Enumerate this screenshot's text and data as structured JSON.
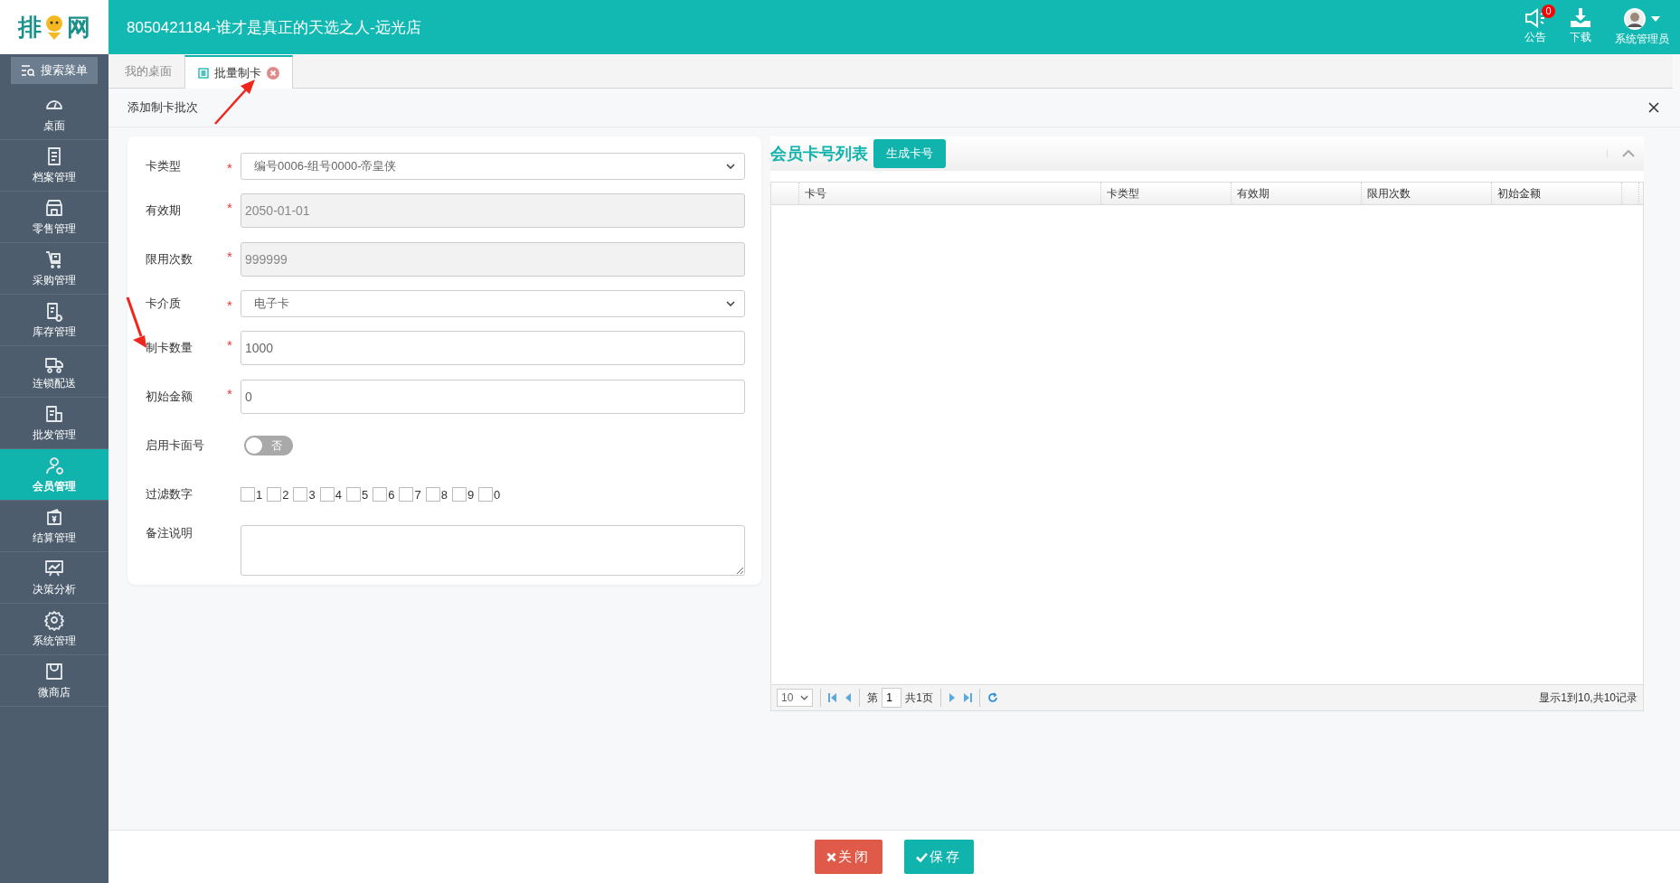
{
  "header": {
    "logo": {
      "left": "排",
      "right": "网"
    },
    "title": "8050421184-谁才是真正的天选之人-远光店",
    "actions": [
      {
        "kind": "notice",
        "label": "公告",
        "badge": "0"
      },
      {
        "kind": "download",
        "label": "下载"
      },
      {
        "kind": "user",
        "label": "系统管理员"
      }
    ]
  },
  "sidebar": {
    "search_button": "搜索菜单",
    "items": [
      {
        "label": "桌面",
        "selected": false
      },
      {
        "label": "档案管理",
        "selected": false
      },
      {
        "label": "零售管理",
        "selected": false
      },
      {
        "label": "采购管理",
        "selected": false
      },
      {
        "label": "库存管理",
        "selected": false
      },
      {
        "label": "连锁配送",
        "selected": false
      },
      {
        "label": "批发管理",
        "selected": false
      },
      {
        "label": "会员管理",
        "selected": true
      },
      {
        "label": "结算管理",
        "selected": false
      },
      {
        "label": "决策分析",
        "selected": false
      },
      {
        "label": "系统管理",
        "selected": false
      },
      {
        "label": "微商店",
        "selected": false
      }
    ]
  },
  "tabs": [
    {
      "label": "我的桌面",
      "selected": false,
      "closable": false
    },
    {
      "label": "批量制卡",
      "selected": true,
      "closable": true
    }
  ],
  "panel_title": "添加制卡批次",
  "form": [
    {
      "kind": "select",
      "label": "卡类型",
      "required_mark": "*",
      "value": "编号0006-组号0000-帝皇侠"
    },
    {
      "kind": "input",
      "label": "有效期",
      "required_mark": "*",
      "value": "2050-01-01",
      "disabled": true
    },
    {
      "kind": "input",
      "label": "限用次数",
      "required_mark": "*",
      "value": "999999",
      "disabled": true
    },
    {
      "kind": "select",
      "label": "卡介质",
      "required_mark": "*",
      "value": "电子卡"
    },
    {
      "kind": "input",
      "label": "制卡数量",
      "required_mark": "*",
      "value": "1000",
      "disabled": false
    },
    {
      "kind": "input",
      "label": "初始金额",
      "required_mark": "*",
      "value": "0",
      "disabled": false
    },
    {
      "kind": "switch",
      "label": "启用卡面号",
      "on": false,
      "text": "否"
    },
    {
      "kind": "checkboxes",
      "label": "过滤数字",
      "options": [
        {
          "label": "1",
          "checked": false
        },
        {
          "label": "2",
          "checked": false
        },
        {
          "label": "3",
          "checked": false
        },
        {
          "label": "4",
          "checked": false
        },
        {
          "label": "5",
          "checked": false
        },
        {
          "label": "6",
          "checked": false
        },
        {
          "label": "7",
          "checked": false
        },
        {
          "label": "8",
          "checked": false
        },
        {
          "label": "9",
          "checked": false
        },
        {
          "label": "0",
          "checked": false
        }
      ]
    },
    {
      "kind": "textarea",
      "label": "备注说明"
    }
  ],
  "card_list": {
    "title": "会员卡号列表",
    "generate_button": "生成卡号",
    "columns": [
      "卡号",
      "卡类型",
      "有效期",
      "限用次数",
      "初始金额"
    ],
    "pagination": {
      "page_size": "10",
      "page_prefix": "第",
      "page": "1",
      "page_suffix": "共1页",
      "summary": "显示1到10,共10记录"
    }
  },
  "footer_buttons": [
    {
      "kind": "close",
      "label": "关闭"
    },
    {
      "kind": "save",
      "label": "保存"
    }
  ]
}
